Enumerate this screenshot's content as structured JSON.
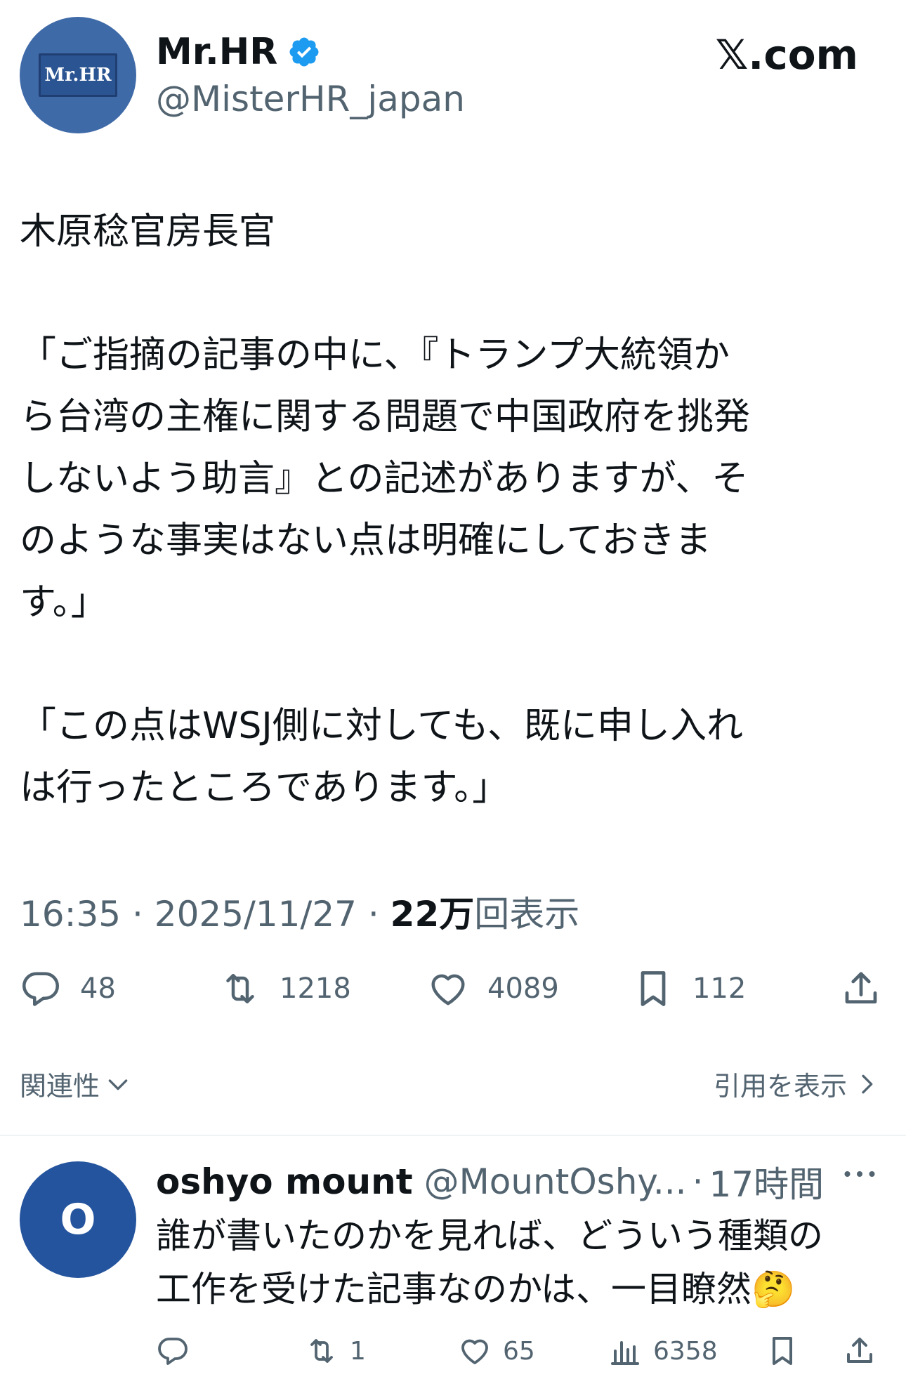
{
  "author": {
    "avatar_text": "Mr.HR",
    "name": "Mr.HR",
    "handle": "@MisterHR_japan",
    "verified": true
  },
  "brand": "𝕏.com",
  "tweet": {
    "text": "木原稔官房長官\n\n「ご指摘の記事の中に、『トランプ大統領か\nら台湾の主権に関する問題で中国政府を挑発\nしないよう助言』との記述がありますが、そ\nのような事実はない点は明確にしておきま\nす。」\n\n「この点はWSJ側に対しても、既に申し入れ\nは行ったところであります。」",
    "time": "16:35",
    "date": "2025/11/27",
    "sep": " · ",
    "views_count": "22万",
    "views_label": "回表示"
  },
  "stats": {
    "replies": "48",
    "reposts": "1218",
    "likes": "4089",
    "bookmarks": "112"
  },
  "sort": {
    "label": "関連性",
    "quotes_label": "引用を表示"
  },
  "reply": {
    "avatar_letter": "O",
    "name": "oshyo mount",
    "handle": "@MountOshy...",
    "dot": "·",
    "time": "17時間",
    "text": "誰が書いたのかを見れば、どういう種類の\n工作を受けた記事なのかは、一目瞭然🤔",
    "replies": "",
    "reposts": "1",
    "likes": "65",
    "views": "6358"
  },
  "colors": {
    "text": "#0f1419",
    "secondary": "#536471",
    "verified": "#1d9bf0",
    "avatar_main": "#3f6aa8",
    "avatar_reply": "#24549d"
  }
}
